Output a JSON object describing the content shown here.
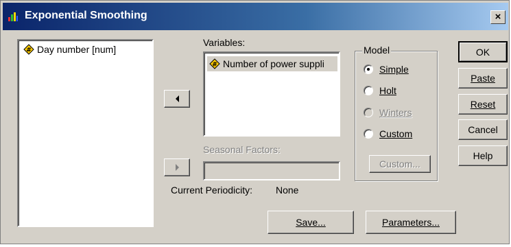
{
  "window": {
    "title": "Exponential Smoothing",
    "close_glyph": "×"
  },
  "source_list": {
    "items": [
      {
        "label": "Day number [num]",
        "icon": "numeric-variable-icon"
      }
    ]
  },
  "variables": {
    "label": "Variables:",
    "items": [
      {
        "label": "Number of power suppli",
        "icon": "numeric-variable-icon"
      }
    ]
  },
  "seasonal_factors": {
    "label": "Seasonal Factors:",
    "value": ""
  },
  "periodicity": {
    "label": "Current Periodicity:",
    "value": "None"
  },
  "model": {
    "label": "Model",
    "options": [
      {
        "label": "Simple",
        "checked": true,
        "enabled": true
      },
      {
        "label": "Holt",
        "checked": false,
        "enabled": true
      },
      {
        "label": "Winters",
        "checked": false,
        "enabled": false
      },
      {
        "label": "Custom",
        "checked": false,
        "enabled": true
      }
    ],
    "custom_button": "Custom..."
  },
  "buttons": {
    "ok": "OK",
    "paste": "Paste",
    "reset": "Reset",
    "cancel": "Cancel",
    "help": "Help",
    "save": "Save...",
    "parameters": "Parameters..."
  },
  "colors": {
    "title_bar_start": "#0a246a",
    "title_bar_end": "#a6caf0",
    "dialog_face": "#d4d0c8",
    "disabled_text": "#808080",
    "variable_icon": "#ffcc00"
  }
}
